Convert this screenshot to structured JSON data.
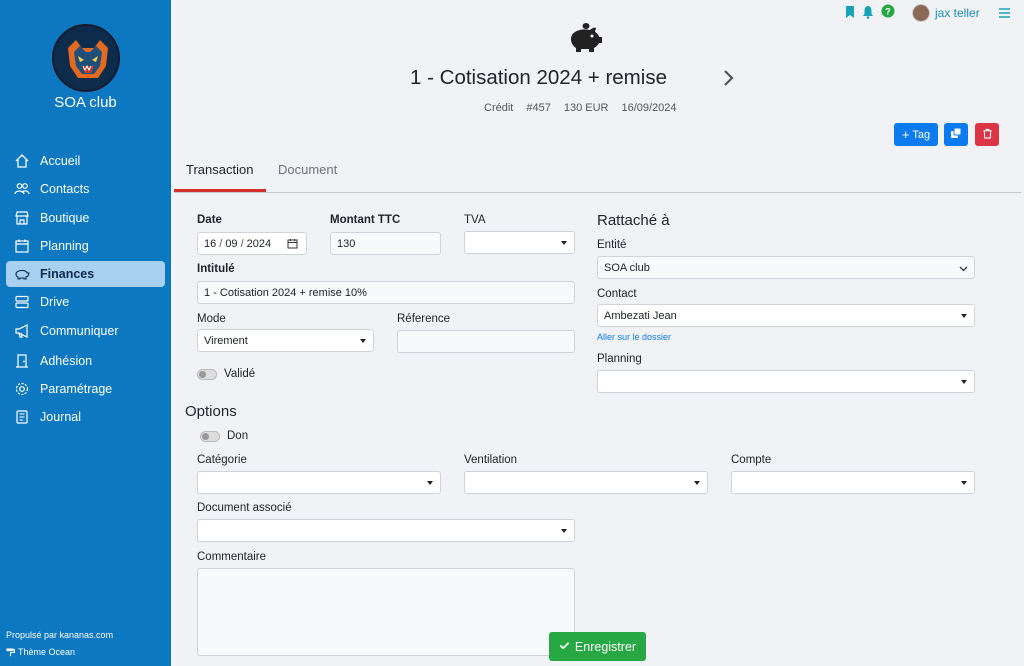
{
  "sidebar": {
    "club_name": "SOA club",
    "items": [
      {
        "label": "Accueil",
        "icon": "home-icon"
      },
      {
        "label": "Contacts",
        "icon": "users-icon"
      },
      {
        "label": "Boutique",
        "icon": "shop-icon"
      },
      {
        "label": "Planning",
        "icon": "calendar-icon"
      },
      {
        "label": "Finances",
        "icon": "piggy-bank-icon",
        "active": true
      },
      {
        "label": "Drive",
        "icon": "drive-icon"
      },
      {
        "label": "Communiquer",
        "icon": "megaphone-icon"
      },
      {
        "label": "Adhésion",
        "icon": "door-icon"
      },
      {
        "label": "Paramétrage",
        "icon": "gear-icon"
      },
      {
        "label": "Journal",
        "icon": "journal-icon"
      }
    ],
    "footer_powered": "Propulsé par kananas.com",
    "footer_theme": "Thème Ocean"
  },
  "topbar": {
    "user_name": "jax teller"
  },
  "header": {
    "title": "1 - Cotisation 2024 + remise",
    "type": "Crédit",
    "number": "#457",
    "amount": "130 EUR",
    "date": "16/09/2024",
    "tag_label": "Tag"
  },
  "tabs": [
    "Transaction",
    "Document"
  ],
  "form": {
    "date_label": "Date",
    "date_day": "16",
    "date_month": "09",
    "date_year": "2024",
    "amount_label": "Montant TTC",
    "amount_value": "130",
    "tva_label": "TVA",
    "tva_value": "",
    "title_label": "Intitulé",
    "title_value": "1 - Cotisation 2024 + remise 10%",
    "mode_label": "Mode",
    "mode_value": "Virement",
    "reference_label": "Réference",
    "reference_value": "",
    "validated_label": "Validé",
    "options_title": "Options",
    "don_label": "Don",
    "category_label": "Catégorie",
    "ventilation_label": "Ventilation",
    "account_label": "Compte",
    "document_label": "Document associé",
    "comment_label": "Commentaire",
    "save_label": "Enregistrer"
  },
  "attachment": {
    "title": "Rattaché à",
    "entity_label": "Entité",
    "entity_value": "SOA club",
    "contact_label": "Contact",
    "contact_value": "Ambezati Jean",
    "contact_link": "Aller sur le dossier",
    "planning_label": "Planning",
    "planning_value": ""
  },
  "colors": {
    "sidebar": "#0b78c1",
    "primary": "#0d7bf0",
    "danger": "#dc3545",
    "success": "#28a745",
    "tab_underline": "#d32f2f"
  }
}
